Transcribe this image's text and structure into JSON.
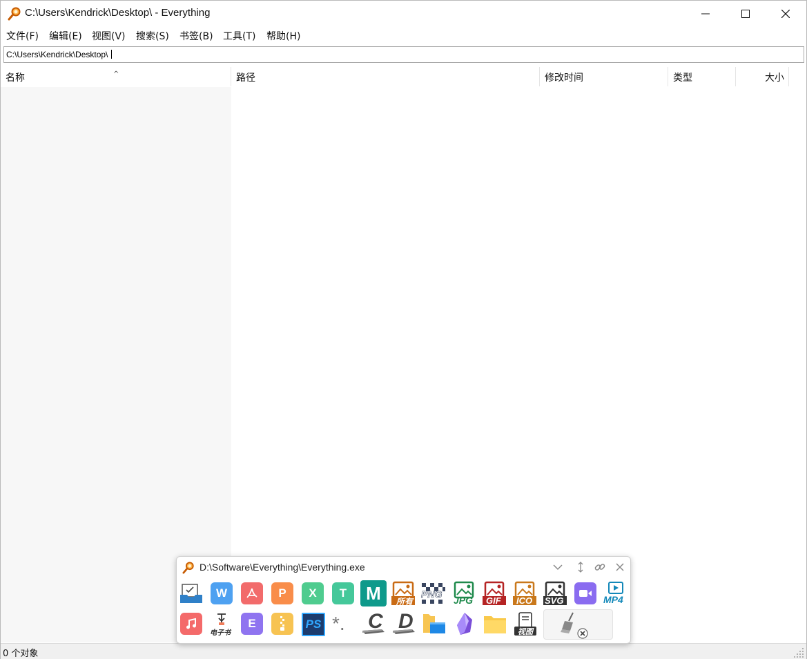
{
  "window": {
    "title": "C:\\Users\\Kendrick\\Desktop\\  - Everything",
    "icon": "magnifier-icon",
    "controls": [
      "minimize-icon",
      "maximize-icon",
      "close-icon"
    ]
  },
  "menu": [
    {
      "label": "文件(F)"
    },
    {
      "label": "编辑(E)"
    },
    {
      "label": "视图(V)"
    },
    {
      "label": "搜索(S)"
    },
    {
      "label": "书签(B)"
    },
    {
      "label": "工具(T)"
    },
    {
      "label": "帮助(H)"
    }
  ],
  "search": {
    "value": "C:\\Users\\Kendrick\\Desktop\\"
  },
  "columns": [
    {
      "label": "名称",
      "sort": "ascending"
    },
    {
      "label": "路径"
    },
    {
      "label": "修改时间"
    },
    {
      "label": "类型"
    },
    {
      "label": "大小"
    }
  ],
  "status": {
    "text": "0 个对象"
  },
  "popup": {
    "title": "D:\\Software\\Everything\\Everything.exe",
    "controls": [
      "chevron-down-icon",
      "vertical-resize-icon",
      "link-icon",
      "close-icon"
    ],
    "row1": [
      {
        "name": "inbox-check-icon",
        "color": "#2f80c8"
      },
      {
        "name": "wps-word-icon",
        "text": "W",
        "color": "#4ea1f1"
      },
      {
        "name": "pdf-icon",
        "color": "#f26b6b"
      },
      {
        "name": "wps-presentation-icon",
        "text": "P",
        "color": "#f98d4a"
      },
      {
        "name": "wps-spreadsheet-icon",
        "text": "X",
        "color": "#4fcc8f"
      },
      {
        "name": "text-doc-icon",
        "text": "T",
        "color": "#45c89a"
      },
      {
        "name": "markdown-icon",
        "text": "M",
        "color": "#0e9a8b"
      },
      {
        "name": "all-images-icon",
        "text": "所有",
        "color": "#c96b15"
      },
      {
        "name": "png-icon",
        "text": "PNG",
        "color": "#3a4660"
      },
      {
        "name": "jpg-icon",
        "text": "JPG",
        "color": "#1f8a4c"
      },
      {
        "name": "gif-icon",
        "text": "GIF",
        "color": "#b52424"
      },
      {
        "name": "ico-icon",
        "text": "ICO",
        "color": "#c9781b"
      },
      {
        "name": "svg-icon",
        "text": "SVG",
        "color": "#333333"
      },
      {
        "name": "video-icon",
        "color": "#8a6cf0"
      },
      {
        "name": "mp4-icon",
        "text": "MP4",
        "color": "#1388b9"
      }
    ],
    "row2": [
      {
        "name": "music-icon",
        "color": "#f46a6a"
      },
      {
        "name": "ebook-icon",
        "text": "电子书",
        "color": "#333333"
      },
      {
        "name": "epub-icon",
        "text": "E",
        "color": "#8f74f0"
      },
      {
        "name": "zip-archive-icon",
        "color": "#f7c352"
      },
      {
        "name": "photoshop-icon",
        "text": "PS",
        "color": "#1c3c6e"
      },
      {
        "name": "asterisk-wildcard-icon",
        "text": "*.",
        "color": "#777777"
      },
      {
        "name": "c-drive-icon",
        "text": "C",
        "color": "#444444"
      },
      {
        "name": "d-drive-icon",
        "text": "D",
        "color": "#444444"
      },
      {
        "name": "folder-window-icon",
        "color": "#f7c552"
      },
      {
        "name": "obsidian-icon",
        "color": "#7a4ed8"
      },
      {
        "name": "folder-icon",
        "color": "#f9c94a"
      },
      {
        "name": "view-doc-icon",
        "text": "视图",
        "color": "#333333"
      },
      {
        "name": "broom-clear-icon",
        "color": "#666666"
      }
    ]
  }
}
